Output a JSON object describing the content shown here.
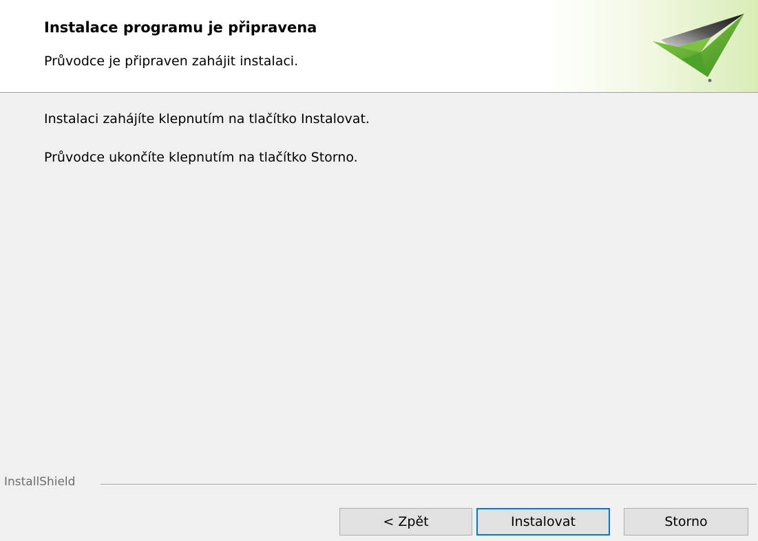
{
  "header": {
    "title": "Instalace programu je připravena",
    "subtitle": "Průvodce je připraven zahájit instalaci.",
    "logo_icon": "installshield-checkmark-logo-icon"
  },
  "body": {
    "line1": "Instalaci zahájíte klepnutím na tlačítko Instalovat.",
    "line2": "Průvodce ukončíte klepnutím na tlačítko Storno."
  },
  "footer": {
    "brand": "InstallShield"
  },
  "buttons": {
    "back": "< Zpět",
    "install": "Instalovat",
    "cancel": "Storno"
  },
  "colors": {
    "logo_green": "#5bb030",
    "logo_dark": "#2d2d2d",
    "focus_border": "#0078d7"
  }
}
